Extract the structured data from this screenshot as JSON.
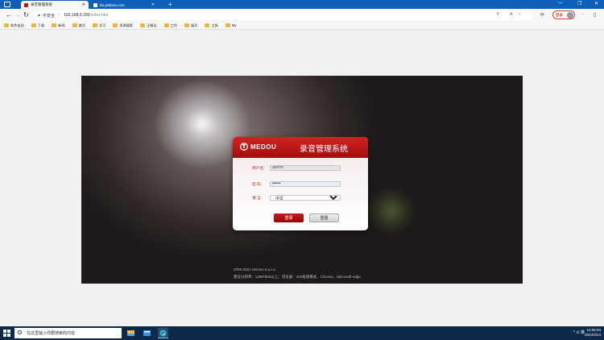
{
  "browser": {
    "tabs": [
      {
        "title": "录音管理系统",
        "active": true
      },
      {
        "title": "blx.jelliedu.com",
        "active": false
      }
    ],
    "new_tab_label": "+",
    "security_label": "不安全",
    "url_host": "192.168.0.100",
    "url_path": "/index.htm",
    "login_label": "登录",
    "bookmarks": [
      "软件出站",
      "下载",
      "新闻",
      "激活",
      "学习",
      "资源搜索",
      "王畅达",
      "工作",
      "娱乐",
      "工具",
      "My"
    ]
  },
  "login_page": {
    "brand": "MEDOU",
    "title": "录音管理系统",
    "username_label": "用户名:",
    "username_value": "admin",
    "password_label": "密  码:",
    "password_value": "••••••",
    "language_label": "语  言:",
    "language_value": "中文",
    "login_button": "登录",
    "reset_button": "重置",
    "copyright": "2009-2021 Version 5.x.x.x",
    "requirements": "建议分辨率：1280*960以上；浏览器：360极速模式、Chrome、Microsoft edge"
  },
  "taskbar": {
    "search_placeholder": "在这里输入你要搜索的内容",
    "tray_wifi": "^ ⊙ 英",
    "time": "12:05:03",
    "date": "2024/3/14"
  },
  "colors": {
    "accent_red": "#c01515",
    "tab_blue": "#0e5fb9",
    "taskbar": "#0d2a4a"
  }
}
